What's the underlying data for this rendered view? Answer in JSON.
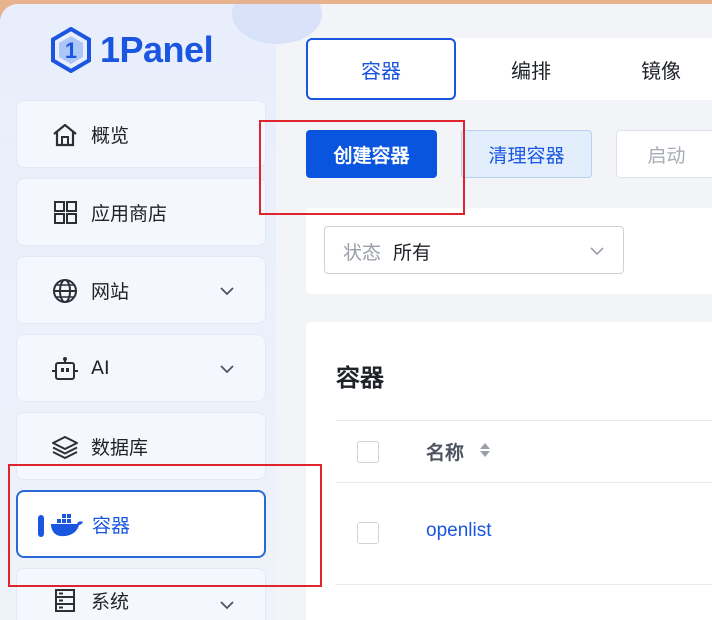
{
  "app": {
    "logo_text": "1Panel"
  },
  "sidebar": {
    "items": [
      {
        "label": "概览",
        "icon": "home-icon",
        "expandable": false,
        "active": false
      },
      {
        "label": "应用商店",
        "icon": "apps-grid-icon",
        "expandable": false,
        "active": false
      },
      {
        "label": "网站",
        "icon": "globe-icon",
        "expandable": true,
        "active": false
      },
      {
        "label": "AI",
        "icon": "robot-icon",
        "expandable": true,
        "active": false
      },
      {
        "label": "数据库",
        "icon": "database-layers-icon",
        "expandable": false,
        "active": false
      },
      {
        "label": "容器",
        "icon": "docker-whale-icon",
        "expandable": false,
        "active": true
      },
      {
        "label": "系统",
        "icon": "server-icon",
        "expandable": true,
        "active": false
      }
    ]
  },
  "tabs": [
    {
      "label": "容器",
      "active": true
    },
    {
      "label": "编排",
      "active": false
    },
    {
      "label": "镜像",
      "active": false
    }
  ],
  "toolbar": {
    "create_label": "创建容器",
    "clean_label": "清理容器",
    "start_label": "启动"
  },
  "filter": {
    "status_prefix": "状态",
    "status_value": "所有"
  },
  "table": {
    "title": "容器",
    "columns": [
      {
        "label": "名称",
        "sortable": true
      }
    ],
    "rows": [
      {
        "name": "openlist"
      }
    ]
  },
  "colors": {
    "accent": "#1a56e0",
    "primary_button": "#0a55e0",
    "highlight_box": "#e0242c",
    "background_border": "#e7b28e"
  }
}
